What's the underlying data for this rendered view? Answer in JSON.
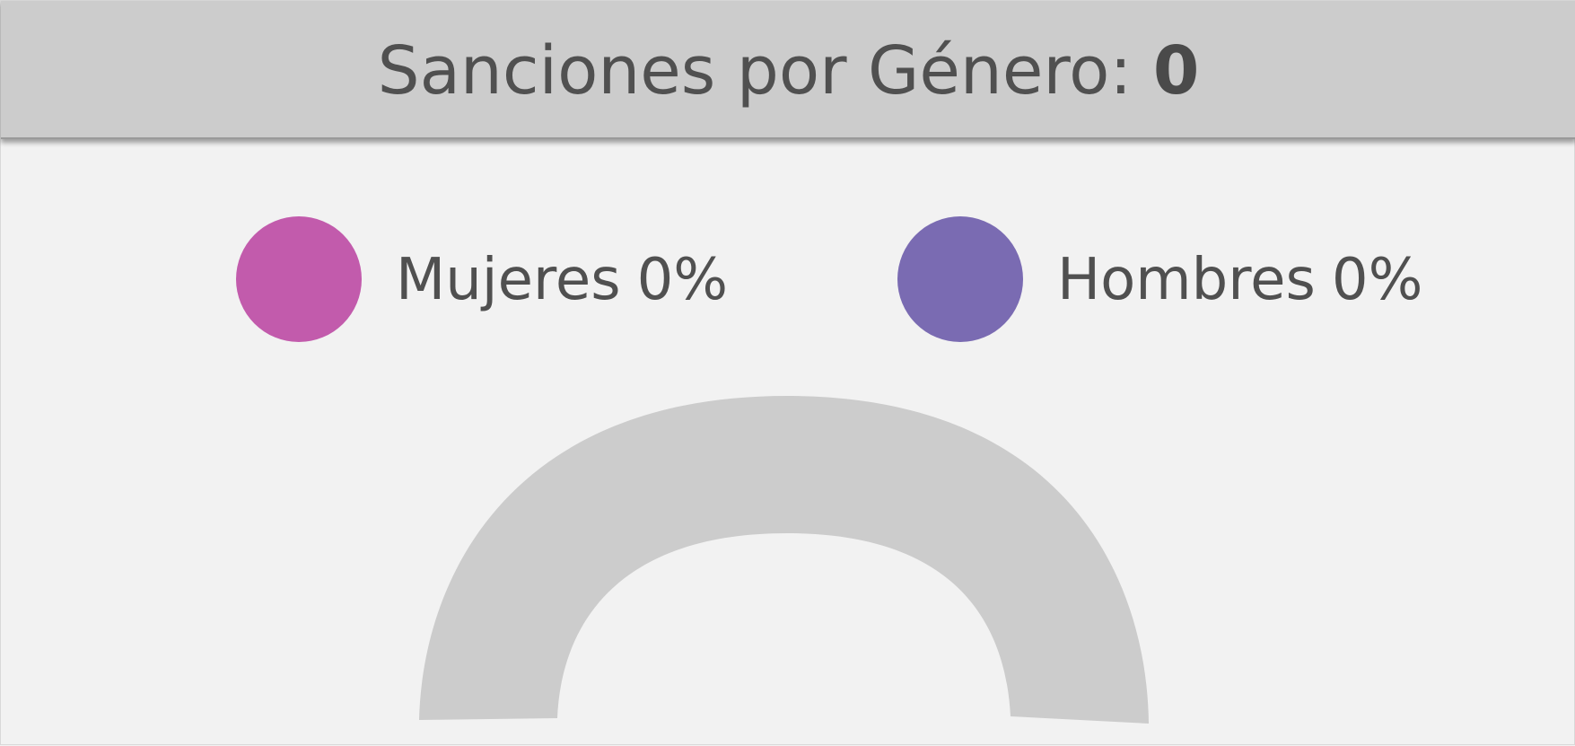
{
  "header": {
    "title": "Sanciones por Género:",
    "total": "0"
  },
  "colors": {
    "women": "#c25bac",
    "men": "#7a6bb2",
    "track": "#cccccc",
    "header_bg": "#cccccc",
    "text": "#505050"
  },
  "chart_data": {
    "type": "gauge",
    "title": "Sanciones por Género: 0",
    "legend": [
      {
        "name": "Mujeres",
        "percent_label": "0%",
        "value": 0,
        "color": "#c25bac"
      },
      {
        "name": "Hombres",
        "percent_label": "0%",
        "value": 0,
        "color": "#7a6bb2"
      }
    ],
    "total": 0,
    "gauge_fill_fraction": 0
  }
}
